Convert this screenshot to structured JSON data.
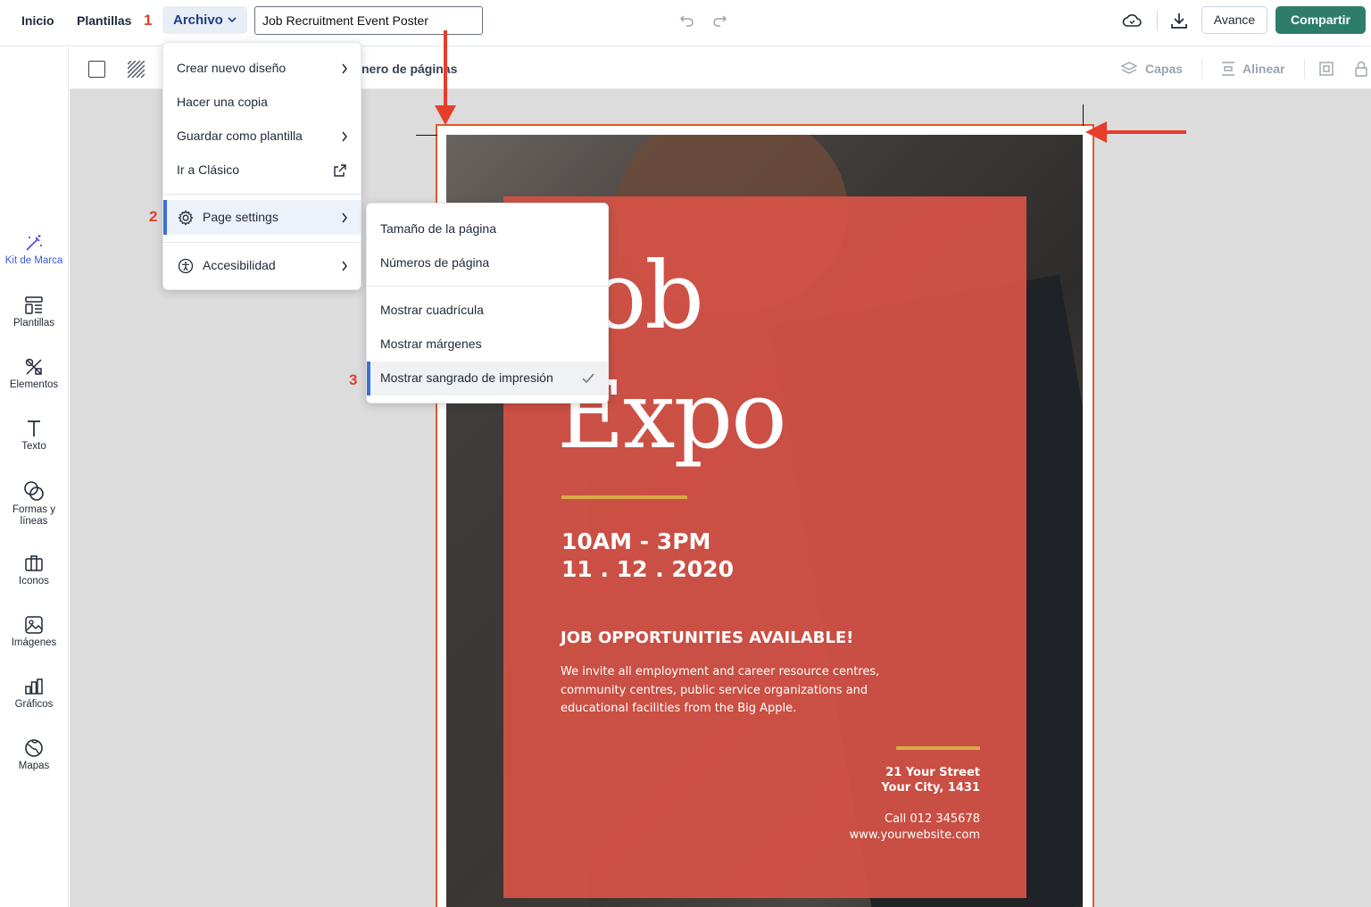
{
  "topbar": {
    "nav_home": "Inicio",
    "nav_templates": "Plantillas",
    "file_menu": "Archivo",
    "document_title": "Job Recruitment Event Poster",
    "preview": "Avance",
    "share": "Compartir"
  },
  "toolbar": {
    "page_numbers_partial": "nero de páginas",
    "layers": "Capas",
    "align": "Alinear"
  },
  "sidebar": {
    "items": [
      {
        "label": "Kit de Marca",
        "icon": "magic-wand-icon"
      },
      {
        "label": "Plantillas",
        "icon": "templates-icon"
      },
      {
        "label": "Elementos",
        "icon": "elements-icon"
      },
      {
        "label": "Texto",
        "icon": "text-icon"
      },
      {
        "label": "Formas y líneas",
        "icon": "shapes-icon"
      },
      {
        "label": "Iconos",
        "icon": "briefcase-icon"
      },
      {
        "label": "Imágenes",
        "icon": "image-icon"
      },
      {
        "label": "Gráficos",
        "icon": "chart-icon"
      },
      {
        "label": "Mapas",
        "icon": "globe-icon"
      }
    ]
  },
  "file_menu": {
    "items": [
      {
        "label": "Crear nuevo diseño",
        "icon": "chevron-right-icon"
      },
      {
        "label": "Hacer una copia"
      },
      {
        "label": "Guardar como plantilla",
        "icon": "chevron-right-icon"
      },
      {
        "label": "Ir a Clásico",
        "icon": "external-link-icon"
      },
      {
        "label": "Page settings",
        "icon": "gear-icon"
      },
      {
        "label": "Accesibilidad",
        "icon": "accessibility-icon"
      }
    ]
  },
  "page_settings_menu": {
    "items": [
      {
        "label": "Tamaño de la página"
      },
      {
        "label": "Números de página"
      },
      {
        "label": "Mostrar cuadrícula"
      },
      {
        "label": "Mostrar márgenes"
      },
      {
        "label": "Mostrar sangrado de impresión",
        "checked": true
      }
    ]
  },
  "callouts": {
    "one": "1",
    "two": "2",
    "three": "3"
  },
  "poster": {
    "title_line1": "Job",
    "title_line2": "Expo",
    "time": "10AM - 3PM",
    "date": "11 . 12 . 2020",
    "headline": "JOB OPPORTUNITIES AVAILABLE!",
    "body_line1": "We invite all employment and career resource centres,",
    "body_line2": "community centres, public service organizations and",
    "body_line3": "educational facilities from the Big Apple.",
    "street": "21 Your Street",
    "city": "Your City, 1431",
    "phone": "Call 012 345678",
    "website": "www.yourwebsite.com"
  },
  "colors": {
    "accent_red": "#e53e2b",
    "panel_red": "#d65246",
    "share_green": "#2e7d6b",
    "gold_rule": "#d9a94a",
    "bleed_line": "#e05a2b"
  }
}
